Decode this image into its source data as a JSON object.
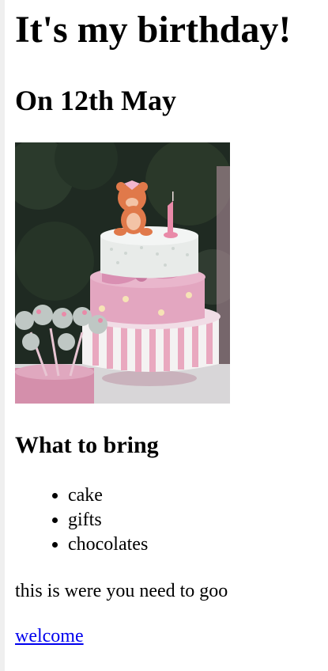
{
  "page": {
    "title": "It's my birthday!",
    "date": "On 12th May"
  },
  "image": {
    "alt": "Pink birthday cake with teddy bear topper",
    "colors": {
      "background_dark": "#1f2a22",
      "cake_white": "#e8ebe9",
      "cake_pink": "#e3a6c0",
      "bow_pink": "#d98fb2",
      "stripe_pink": "#e9a8bf",
      "bear_orange": "#e0794a",
      "candle_pink": "#e98aa8"
    }
  },
  "bring": {
    "heading": "What to bring",
    "items": [
      "cake",
      "gifts",
      "chocolates"
    ]
  },
  "note": "this is were you need to goo",
  "link": {
    "label": "welcome",
    "color": "#0000ee"
  }
}
